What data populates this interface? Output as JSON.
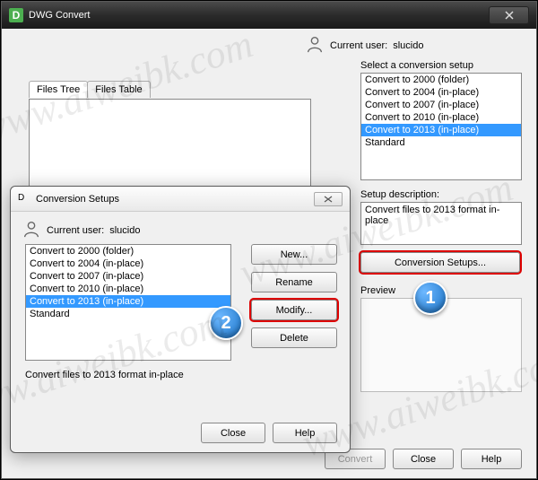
{
  "watermark": "www.aiweibk.com",
  "main": {
    "title": "DWG Convert",
    "current_user_label": "Current user:",
    "current_user": "slucido",
    "tabs": {
      "tree": "Files Tree",
      "table": "Files Table"
    },
    "select_label": "Select a conversion setup",
    "setups": [
      {
        "label": "Convert to 2000 (folder)",
        "selected": false
      },
      {
        "label": "Convert to 2004 (in-place)",
        "selected": false
      },
      {
        "label": "Convert to 2007 (in-place)",
        "selected": false
      },
      {
        "label": "Convert to 2010 (in-place)",
        "selected": false
      },
      {
        "label": "Convert to 2013 (in-place)",
        "selected": true
      },
      {
        "label": "Standard",
        "selected": false
      }
    ],
    "desc_label": "Setup description:",
    "desc_text": "Convert files to 2013 format in-place",
    "conv_setups_btn": "Conversion Setups...",
    "preview_label": "Preview",
    "buttons": {
      "convert": "Convert",
      "close": "Close",
      "help": "Help"
    }
  },
  "dialog": {
    "title": "Conversion Setups",
    "current_user_label": "Current user:",
    "current_user": "slucido",
    "setups": [
      {
        "label": "Convert to 2000 (folder)",
        "selected": false
      },
      {
        "label": "Convert to 2004 (in-place)",
        "selected": false
      },
      {
        "label": "Convert to 2007 (in-place)",
        "selected": false
      },
      {
        "label": "Convert to 2010 (in-place)",
        "selected": false
      },
      {
        "label": "Convert to 2013 (in-place)",
        "selected": true
      },
      {
        "label": "Standard",
        "selected": false
      }
    ],
    "desc_text": "Convert files to 2013 format in-place",
    "buttons": {
      "new": "New...",
      "rename": "Rename",
      "modify": "Modify...",
      "delete": "Delete",
      "close": "Close",
      "help": "Help"
    }
  },
  "badges": {
    "one": "1",
    "two": "2"
  }
}
